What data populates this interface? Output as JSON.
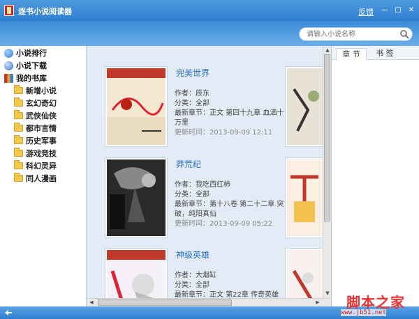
{
  "window": {
    "title": "逐书小说阅读器",
    "feedback_label": "反馈",
    "minimize_glyph": "—",
    "maximize_glyph": "□",
    "close_glyph": "✕"
  },
  "search": {
    "placeholder": "请输入小说名称",
    "icon": "search-icon"
  },
  "sidebar": {
    "items": [
      {
        "label": "小说排行",
        "icon": "globe-icon",
        "color": "#2f7fd0"
      },
      {
        "label": "小说下载",
        "icon": "download-icon",
        "color": "#2f6bbd"
      },
      {
        "label": "我的书库",
        "icon": "books-icon",
        "color": "#8b5a2b"
      }
    ],
    "library": [
      "玄幻奇幻",
      "武侠仙侠",
      "都市言情",
      "历史军事",
      "游戏竞技",
      "科幻灵异",
      "同人漫画"
    ],
    "new_novels_label": "新增小说"
  },
  "books": [
    {
      "title": "完美世界",
      "author": "作者：辰东",
      "category": "分类：全部",
      "latest": "最新章节：正文 第四十九章 血洒十万里",
      "updated": "更新时间：2013-09-09 12:11"
    },
    {
      "title": "莽荒纪",
      "author": "作者：我吃西红柿",
      "category": "分类：全部",
      "latest": "最新章节：第十八卷 第二十二章 突破，纯阳真仙",
      "updated": "更新时间：2013-09-09 05:22"
    },
    {
      "title": "神级英雄",
      "author": "作者：大烟缸",
      "category": "分类：全部",
      "latest": "最新章节：正文 第22章 传奇英雄",
      "updated": ""
    }
  ],
  "right_panel": {
    "tabs": [
      "章 节",
      "书 签"
    ]
  },
  "watermark": {
    "main": "脚本之家",
    "sub": "www.jb51.net"
  },
  "colors": {
    "accent": "#2f7fd0",
    "link": "#2a6fc1",
    "content_bg": "#e3ecf6"
  }
}
